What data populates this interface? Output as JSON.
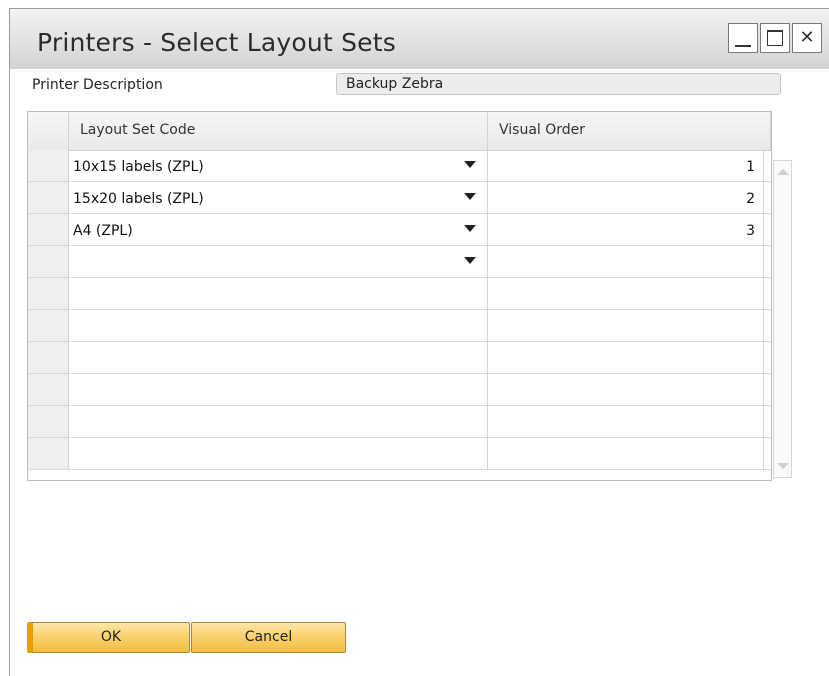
{
  "window": {
    "title": "Printers - Select Layout Sets",
    "controls": {
      "minimize": "minimize-icon",
      "maximize": "maximize-icon",
      "close": "close-icon",
      "close_glyph": "✕"
    }
  },
  "form": {
    "printer_description_label": "Printer Description",
    "printer_description_value": "Backup Zebra"
  },
  "grid": {
    "columns": [
      "Layout Set Code",
      "Visual Order"
    ],
    "rows": [
      {
        "code": "10x15 labels (ZPL)",
        "order": "1"
      },
      {
        "code": "15x20 labels (ZPL)",
        "order": "2"
      },
      {
        "code": "A4 (ZPL)",
        "order": "3"
      },
      {
        "code": "",
        "order": ""
      },
      {
        "code": "",
        "order": ""
      },
      {
        "code": "",
        "order": ""
      },
      {
        "code": "",
        "order": ""
      },
      {
        "code": "",
        "order": ""
      },
      {
        "code": "",
        "order": ""
      },
      {
        "code": "",
        "order": ""
      }
    ]
  },
  "buttons": {
    "ok": "OK",
    "cancel": "Cancel"
  },
  "colors": {
    "button_gradient_top": "#fde7a8",
    "button_gradient_bottom": "#f3bd3e",
    "ok_accent": "#e8a000"
  }
}
